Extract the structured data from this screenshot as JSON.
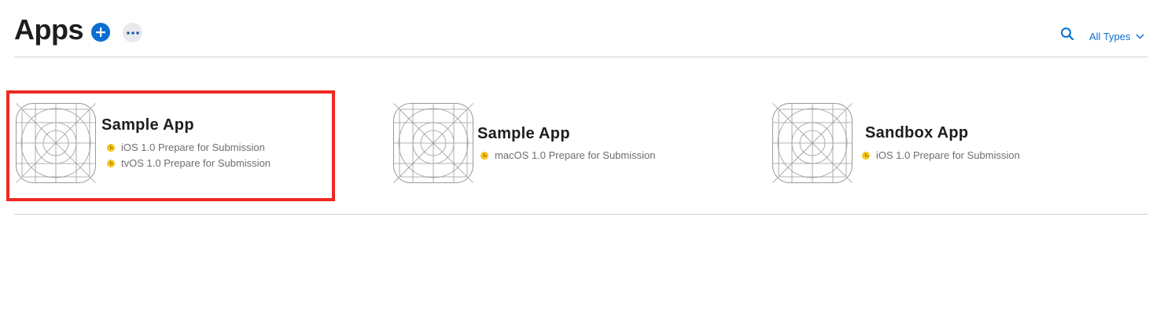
{
  "header": {
    "title": "Apps",
    "add_icon": "plus-circle-icon",
    "more_icon": "ellipsis-icon",
    "search_icon": "search-icon",
    "filter_label": "All Types",
    "filter_icon": "chevron-down-icon"
  },
  "colors": {
    "accent": "#0a6dd1",
    "status_pending": "#f5c518",
    "highlight": "#ee2a24"
  },
  "apps": [
    {
      "name": "Sample App",
      "icon": "app-icon-placeholder",
      "statuses": [
        "iOS 1.0 Prepare for Submission",
        "tvOS 1.0 Prepare for Submission"
      ]
    },
    {
      "name": "Sample App",
      "icon": "app-icon-placeholder",
      "statuses": [
        "macOS 1.0 Prepare for Submission"
      ]
    },
    {
      "name": "Sandbox App",
      "icon": "app-icon-placeholder",
      "statuses": [
        "iOS 1.0 Prepare for Submission"
      ]
    }
  ]
}
